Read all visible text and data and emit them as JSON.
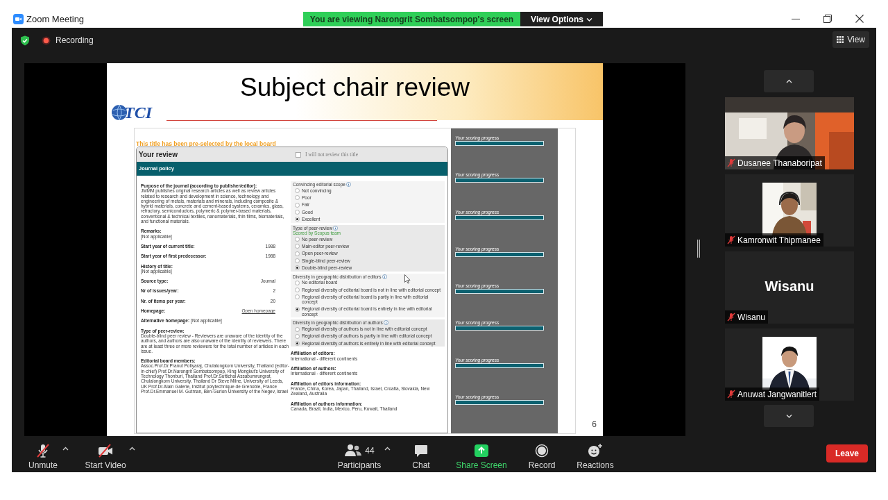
{
  "window": {
    "title": "Zoom Meeting"
  },
  "share_banner": {
    "text": "You are viewing Narongrit Sombatsompop's screen",
    "view_options": "View Options"
  },
  "top_bar": {
    "recording": "Recording",
    "view": "View"
  },
  "slide": {
    "title": "Subject chair review",
    "logo": "TCI",
    "page_number": "6",
    "preselected_note": "This title has been pre-selected by the local board",
    "review": {
      "heading": "Your review",
      "opt_out": {
        "label": "I will not review this title",
        "checked": false
      },
      "section": "Journal policy",
      "fields": [
        {
          "kind": "block",
          "label": "Purpose of the journal (according to publisher/editor):",
          "value": "JMMM publishes original research articles as well as review articles related to research and development in science, technology and engineering of metals, materials and minerals, including composite & hybrid materials, concrete and cement-based systems, ceramics, glass, refractory, semiconductors, polymeric & polymer-based materials, conventional & technical textiles, nanomaterials, thin films, biomaterials, and functional materials."
        },
        {
          "kind": "block",
          "label": "Remarks:",
          "value": "[Not applicable]"
        },
        {
          "kind": "row",
          "label": "Start year of current title:",
          "value": "1988"
        },
        {
          "kind": "row",
          "label": "Start year of first predecessor:",
          "value": "1988"
        },
        {
          "kind": "block",
          "label": "History of title:",
          "value": "[Not applicable]"
        },
        {
          "kind": "row",
          "label": "Source type:",
          "value": "Journal"
        },
        {
          "kind": "row",
          "label": "Nr of issues/year:",
          "value": "2"
        },
        {
          "kind": "row",
          "label": "Nr. of items per year:",
          "value": "20"
        },
        {
          "kind": "link",
          "label": "Homepage:",
          "value": "Open homepage"
        },
        {
          "kind": "inline",
          "label": "Alternative homepage:",
          "value": "[Not applicable]"
        },
        {
          "kind": "block",
          "label": "Type of peer-review:",
          "value": "Double-blind peer review - Reviewers are unaware of the identity of the authors, and authors are also unaware of the identity of reviewers. There are at least three or more reviewers for the total number of articles in each issue."
        },
        {
          "kind": "block",
          "label": "Editorial board members:",
          "value": "Assoc.Prof.Dr.Pranut Potiyaraj, Chulalongkorn University, Thailand (editor-in-chief) Prof.Dr.Narongrit Sombatsompop, King Mongkut's University of Technology Thonburi, Thailand Prof.Dr.Suttichai Assabumrungrat, Chulalongkorn University, Thailand Dr Steve Milne, University of Leeds, UK Prof.Dr.Alain Galerie, Institut polytechnique de Grenoble, France Prof.Dr.Emmanuel M. Gutman, Ben-Gurion University of the Negev, Israel"
        }
      ],
      "criteria": [
        {
          "title": "Convincing editorial scope",
          "options": [
            {
              "label": "Not convincing",
              "selected": false
            },
            {
              "label": "Poor",
              "selected": false
            },
            {
              "label": "Fair",
              "selected": false
            },
            {
              "label": "Good",
              "selected": false
            },
            {
              "label": "Excellent",
              "selected": true
            }
          ]
        },
        {
          "title": "Type of peer-review",
          "note": "Scored by Scopus team",
          "options": [
            {
              "label": "No peer-review",
              "selected": false
            },
            {
              "label": "Main-editor peer-review",
              "selected": false
            },
            {
              "label": "Open peer-review",
              "selected": false
            },
            {
              "label": "Single-blind peer-review",
              "selected": false
            },
            {
              "label": "Double-blind peer-review",
              "selected": true
            }
          ]
        },
        {
          "title": "Diversity in geographic distribution of editors",
          "options": [
            {
              "label": "No editorial board",
              "selected": false
            },
            {
              "label": "Regional diversity of editorial board is not in line with editorial concept",
              "selected": false
            },
            {
              "label": "Regional diversity of editorial board is partly in line with editorial concept",
              "selected": false
            },
            {
              "label": "Regional diversity of editorial board is entirely in line with editorial concept",
              "selected": true
            }
          ]
        },
        {
          "title": "Diversity in geographic distribution of authors",
          "options": [
            {
              "label": "Regional diversity of authors is not in line with editorial concept",
              "selected": false
            },
            {
              "label": "Regional diversity of authors is partly in line with editorial concept",
              "selected": false
            },
            {
              "label": "Regional diversity of authors is entirely in line with editorial concept",
              "selected": true
            }
          ]
        }
      ],
      "affiliations": [
        {
          "label": "Affiliation of editors:",
          "value": "International - different continents"
        },
        {
          "label": "Affiliation of authors:",
          "value": "International - different continents"
        },
        {
          "label": "Affiliation of editors information:",
          "value": "France, China, Korea, Japan, Thailand, Israel, Croatia, Slovakia, New Zealand, Australia"
        },
        {
          "label": "Affiliation of authors information:",
          "value": "Canada, Brazil, India, Mexico, Peru, Kuwait, Thailand"
        }
      ]
    },
    "progress": [
      {
        "label": "Your scoring progress",
        "level": 1
      },
      {
        "label": "Your scoring progress",
        "level": 1
      },
      {
        "label": "Your scoring progress",
        "level": 1
      },
      {
        "label": "Your scoring progress",
        "level": 1
      },
      {
        "label": "Your scoring progress",
        "level": 1
      },
      {
        "label": "Your scoring progress",
        "level": 1
      },
      {
        "label": "Your scoring progress",
        "level": 1
      },
      {
        "label": "Your scoring progress",
        "level": 1
      }
    ]
  },
  "participants": [
    {
      "kind": "video",
      "name": "Dusanee Thanaboripat",
      "muted": true
    },
    {
      "name": "Kamronwit Thipmanee",
      "muted": true
    },
    {
      "kind": "name",
      "display_name": "Wisanu",
      "name": "Wisanu",
      "muted": true
    },
    {
      "name": "Anuwat Jangwanitlert",
      "muted": true
    }
  ],
  "toolbar": [
    {
      "kind": "mic",
      "label": "Unmute",
      "off": true,
      "menu": true
    },
    {
      "kind": "video",
      "label": "Start Video",
      "off": true,
      "menu": true
    },
    {
      "kind": "participants",
      "label": "Participants",
      "count": "44",
      "menu": true
    },
    {
      "kind": "chat",
      "label": "Chat",
      "menu": false
    },
    {
      "kind": "share",
      "label": "Share Screen",
      "menu": false
    },
    {
      "kind": "record",
      "label": "Record",
      "menu": false
    },
    {
      "kind": "reactions",
      "label": "Reactions",
      "menu": false
    }
  ],
  "leave": "Leave"
}
